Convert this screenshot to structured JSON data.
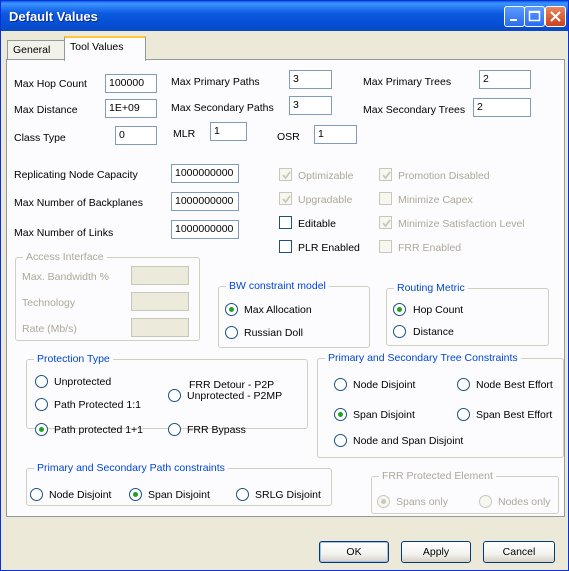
{
  "window": {
    "title": "Default Values"
  },
  "tabs": {
    "general": "General",
    "tool_values": "Tool Values"
  },
  "fields": {
    "max_hop_count": {
      "label": "Max Hop Count",
      "value": "100000"
    },
    "max_primary_paths": {
      "label": "Max Primary Paths",
      "value": "3"
    },
    "max_primary_trees": {
      "label": "Max Primary Trees",
      "value": "2"
    },
    "max_distance": {
      "label": "Max Distance",
      "value": "1E+09"
    },
    "max_secondary_paths": {
      "label": "Max Secondary Paths",
      "value": "3"
    },
    "max_secondary_trees": {
      "label": "Max Secondary Trees",
      "value": "2"
    },
    "class_type": {
      "label": "Class Type",
      "value": "0"
    },
    "mlr": {
      "label": "MLR",
      "value": "1"
    },
    "osr": {
      "label": "OSR",
      "value": "1"
    },
    "replicating_node_capacity": {
      "label": "Replicating Node Capacity",
      "value": "1000000000"
    },
    "max_backplanes": {
      "label": "Max Number of Backplanes",
      "value": "1000000000"
    },
    "max_links": {
      "label": "Max Number of Links",
      "value": "1000000000"
    }
  },
  "checkboxes": {
    "optimizable": "Optimizable",
    "upgradable": "Upgradable",
    "editable": "Editable",
    "plr_enabled": "PLR Enabled",
    "promotion_disabled": "Promotion Disabled",
    "minimize_capex": "Minimize Capex",
    "minimize_satisfaction": "Minimize Satisfaction Level",
    "frr_enabled": "FRR Enabled"
  },
  "access_interface": {
    "title": "Access Interface",
    "max_bandwidth": "Max. Bandwidth %",
    "technology": "Technology",
    "rate": "Rate (Mb/s)"
  },
  "bw_model": {
    "title": "BW constraint model",
    "max_allocation": "Max Allocation",
    "russian_doll": "Russian Doll"
  },
  "routing_metric": {
    "title": "Routing Metric",
    "hop_count": "Hop Count",
    "distance": "Distance"
  },
  "protection_type": {
    "title": "Protection Type",
    "unprotected": "Unprotected",
    "path_protected_1_1": "Path Protected 1:1",
    "path_protected_1_plus_1": "Path protected 1+1",
    "frr_detour_line1": "FRR Detour - P2P",
    "frr_detour_line2": "Unprotected - P2MP",
    "frr_bypass": "FRR Bypass"
  },
  "tree_constraints": {
    "title": "Primary and Secondary Tree Constraints",
    "node_disjoint": "Node Disjoint",
    "node_best_effort": "Node Best Effort",
    "span_disjoint": "Span Disjoint",
    "span_best_effort": "Span Best Effort",
    "node_and_span_disjoint": "Node and Span Disjoint"
  },
  "path_constraints": {
    "title": "Primary and Secondary Path constraints",
    "node_disjoint": "Node Disjoint",
    "span_disjoint": "Span Disjoint",
    "srlg_disjoint": "SRLG Disjoint"
  },
  "frr_protected": {
    "title": "FRR Protected Element",
    "spans_only": "Spans only",
    "nodes_only": "Nodes only"
  },
  "buttons": {
    "ok": "OK",
    "apply": "Apply",
    "cancel": "Cancel"
  }
}
